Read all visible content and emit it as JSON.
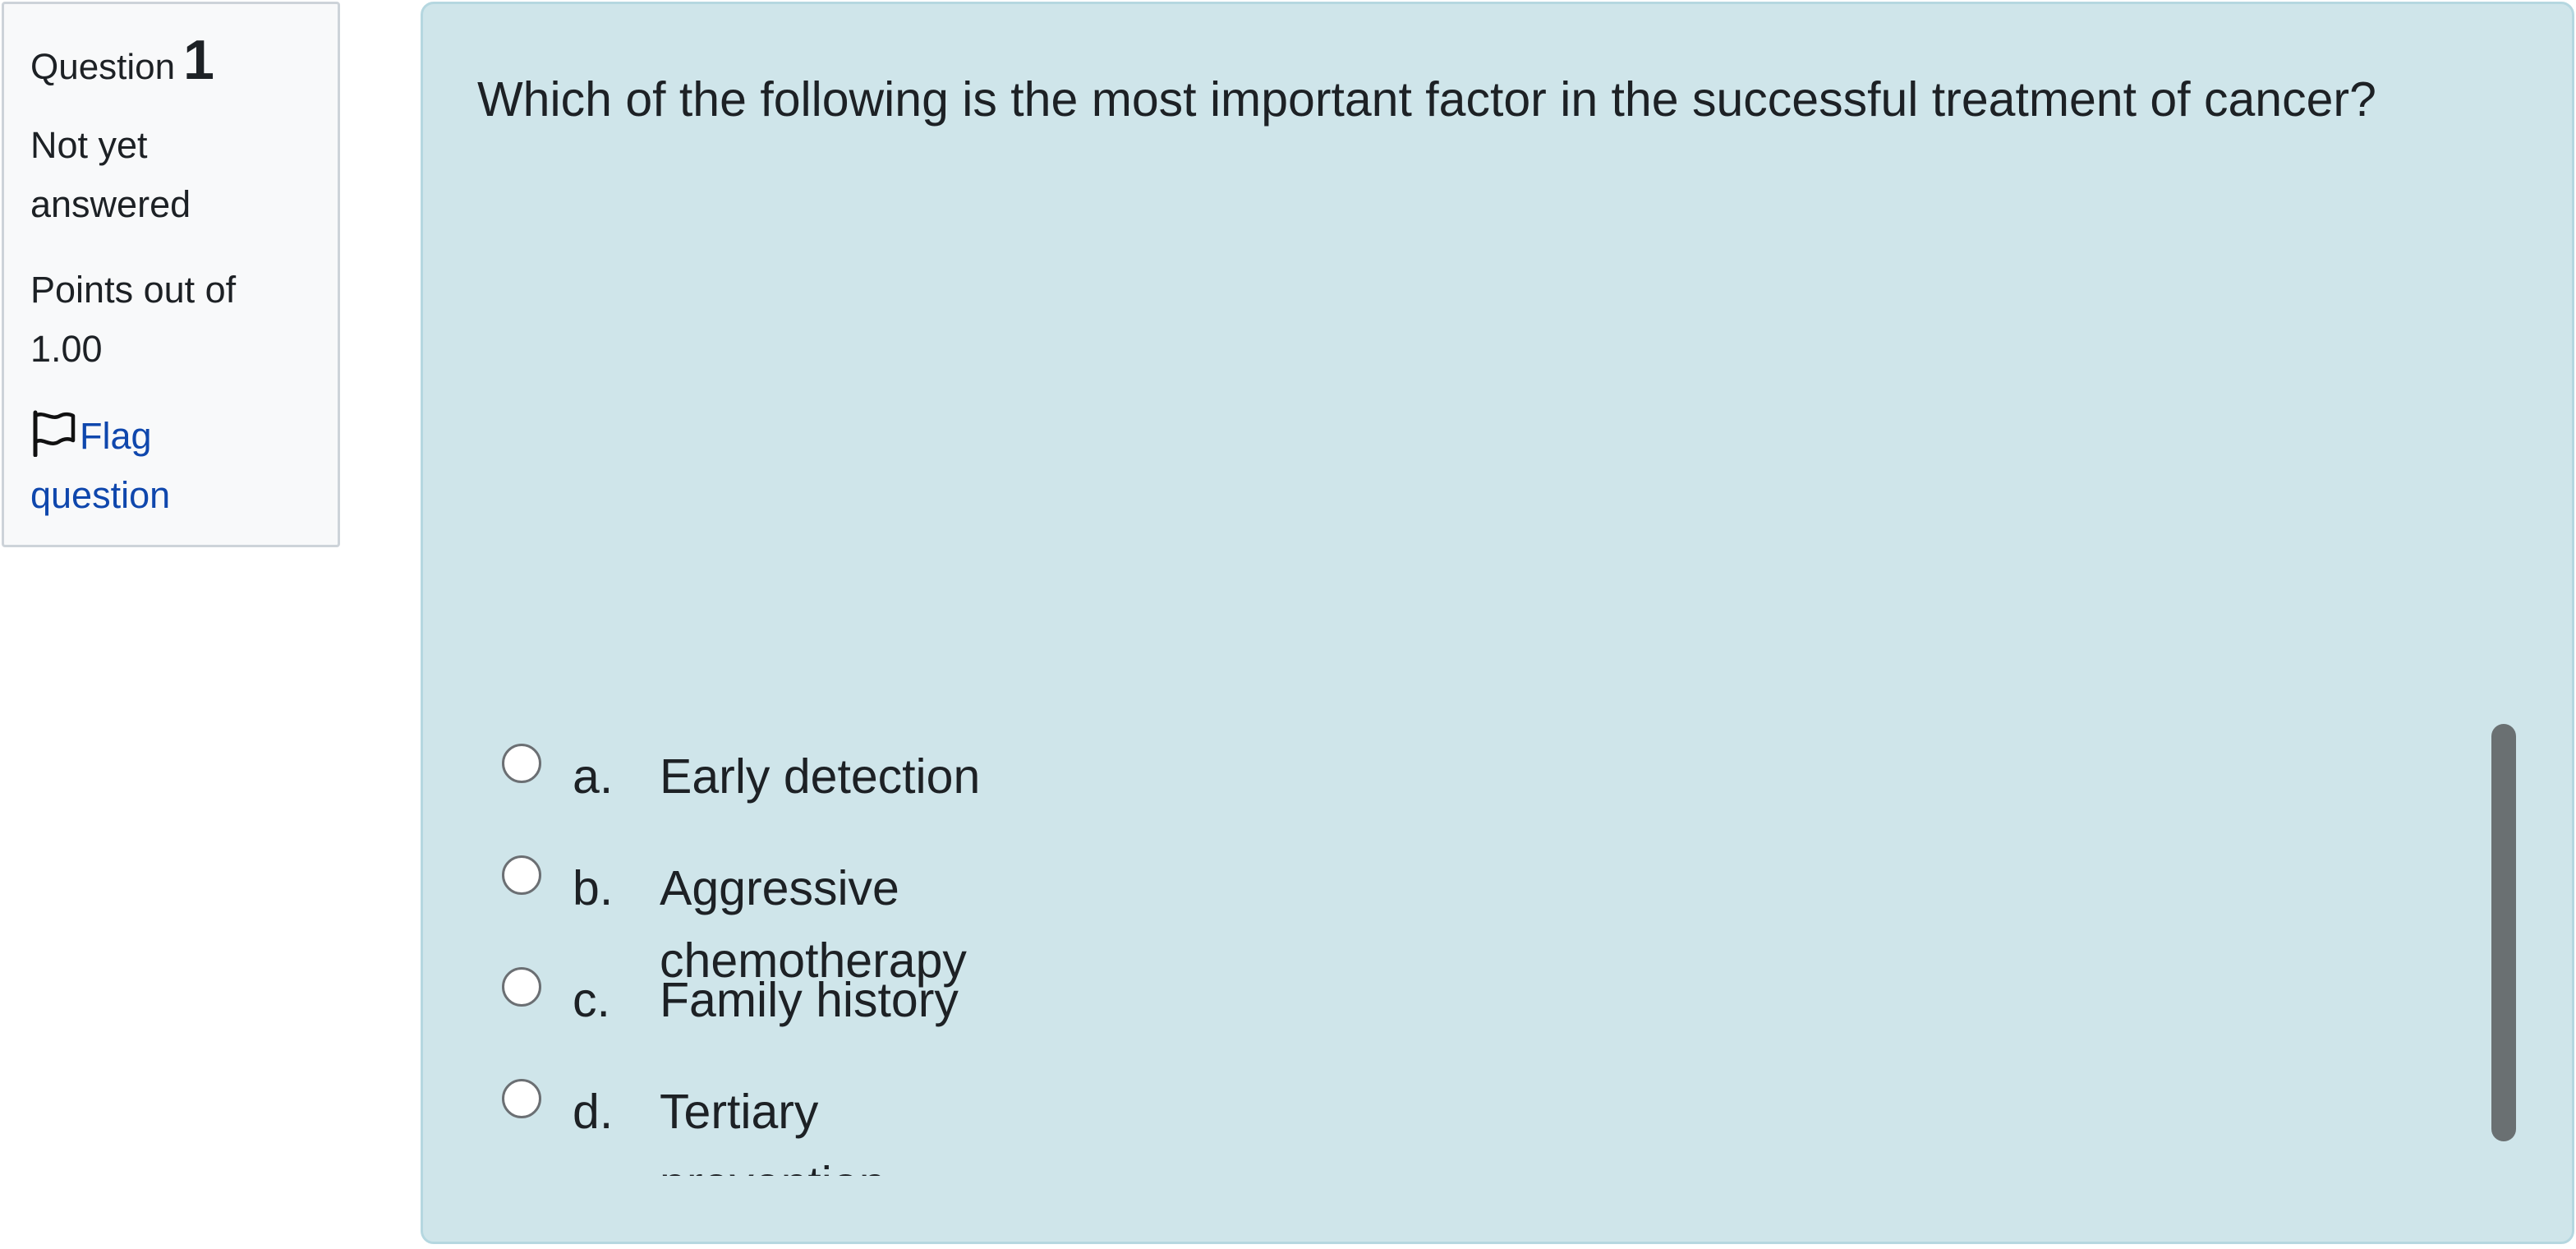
{
  "info": {
    "question_label": "Question",
    "question_number": "1",
    "state": "Not yet answered",
    "grade": "Points out of 1.00",
    "flag_label": "Flag question",
    "flag_icon": "flag-outline-icon"
  },
  "question": {
    "text": "Which of the following is the most important factor in the successful treatment of cancer?"
  },
  "answers": [
    {
      "letter": "a.",
      "label": "Early detection"
    },
    {
      "letter": "b.",
      "label": "Aggressive chemotherapy"
    },
    {
      "letter": "c.",
      "label": "Family history"
    },
    {
      "letter": "d.",
      "label": "Tertiary prevention"
    }
  ],
  "colors": {
    "info_bg": "#f8f9fa",
    "content_bg": "#cfe5ea",
    "link": "#0f47ad",
    "scrollbar": "#6a7072"
  }
}
